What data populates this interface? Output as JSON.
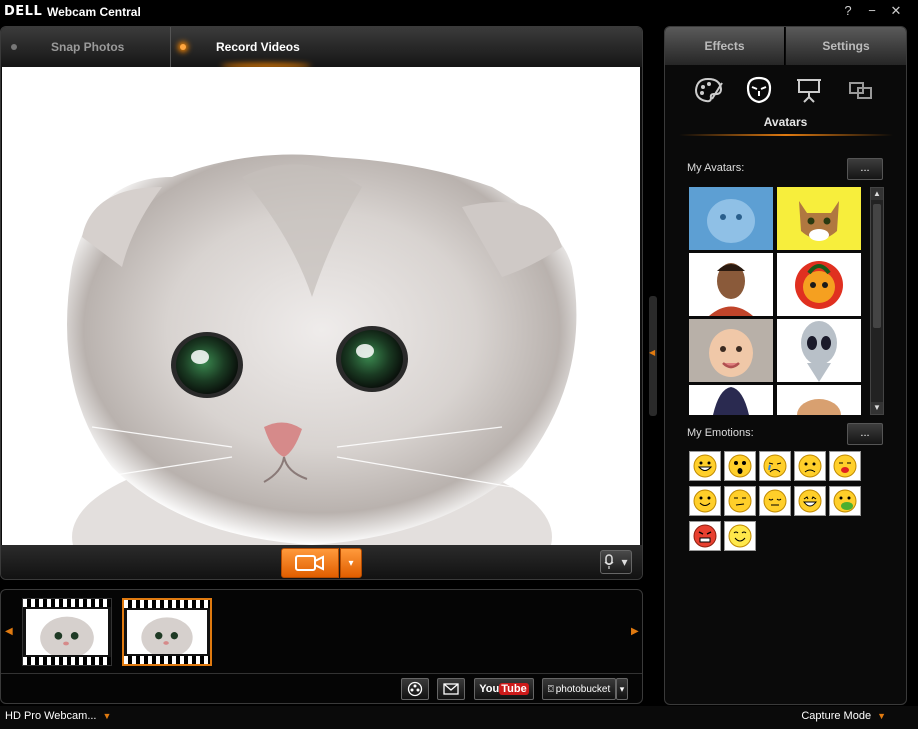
{
  "window": {
    "logo": "DELL",
    "title": "Webcam Central",
    "help": "?",
    "minimize": "−",
    "close": "✕"
  },
  "modes": {
    "snap_label": "Snap Photos",
    "record_label": "Record Videos",
    "active": "Record Videos"
  },
  "controls": {
    "dropdown_caret": "▾",
    "mic_caret": "▾"
  },
  "strip": {
    "left_arrow": "◀",
    "right_arrow": "▶",
    "thumbnail_count": 2,
    "selected_index": 1
  },
  "share": {
    "youtube_you": "You",
    "youtube_tube": "Tube",
    "photobucket": "photobucket",
    "photobucket_caret": "▾"
  },
  "side_tabs": {
    "effects": "Effects",
    "settings": "Settings",
    "active": "Effects"
  },
  "effects": {
    "active_subtitle": "Avatars",
    "icons": [
      "effects-palette-icon",
      "avatar-mask-icon",
      "presentation-icon",
      "picture-in-picture-icon"
    ]
  },
  "avatars": {
    "label": "My Avatars:",
    "more_button": "...",
    "items": [
      "blue-cat",
      "tabby-cat",
      "cartoon-boy",
      "fire-face",
      "baby",
      "alien",
      "hooded-figure",
      "puppy"
    ]
  },
  "emotions": {
    "label": "My Emotions:",
    "more_button": "...",
    "items": [
      "big-grin",
      "surprised",
      "crying",
      "worried",
      "kiss",
      "smile",
      "smirk",
      "sleepy",
      "laughing",
      "sick",
      "angry",
      "happy"
    ]
  },
  "scrollbar": {
    "up": "▲",
    "down": "▼"
  },
  "status": {
    "device": "HD Pro Webcam...",
    "mode": "Capture Mode",
    "caret": "▼"
  },
  "colors": {
    "accent": "#e07a10",
    "background": "#000000",
    "panel_border": "#3a3a3a"
  }
}
